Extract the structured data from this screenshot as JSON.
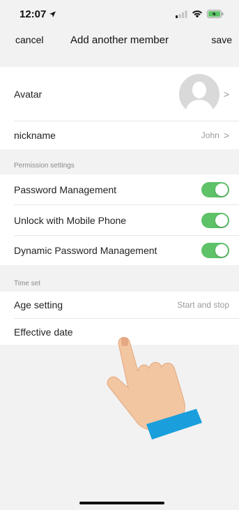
{
  "status_bar": {
    "time": "12:07"
  },
  "nav": {
    "cancel_label": "cancel",
    "title": "Add another member",
    "save_label": "save"
  },
  "profile": {
    "avatar_label": "Avatar",
    "nickname_label": "nickname",
    "nickname_value": "John",
    "chevron": ">"
  },
  "permissions": {
    "section_title": "Permission settings",
    "items": [
      {
        "label": "Password Management",
        "enabled": true
      },
      {
        "label": "Unlock with Mobile Phone",
        "enabled": true
      },
      {
        "label": "Dynamic Password Management",
        "enabled": true
      }
    ]
  },
  "time_set": {
    "section_title": "Time set",
    "age_label": "Age setting",
    "age_value": "Start and stop",
    "effective_label": "Effective date"
  },
  "colors": {
    "toggle_on": "#5ec269",
    "hand_skin": "#f3c6a2",
    "hand_cuff": "#1a9fdc"
  },
  "icons": [
    "location-arrow-icon",
    "signal-icon",
    "wifi-icon",
    "battery-icon",
    "avatar-placeholder-icon",
    "chevron-right-icon",
    "pointing-hand-icon"
  ]
}
